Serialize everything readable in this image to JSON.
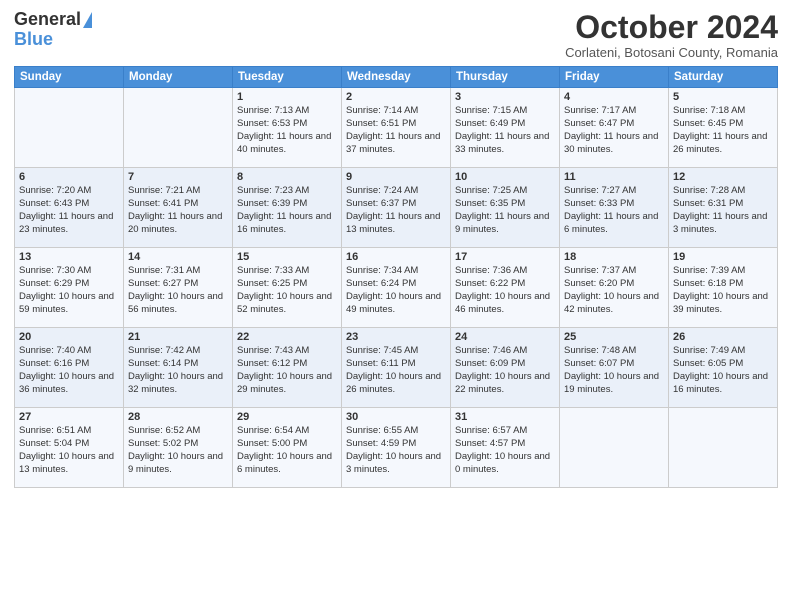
{
  "logo": {
    "general": "General",
    "blue": "Blue"
  },
  "title": "October 2024",
  "subtitle": "Corlateni, Botosani County, Romania",
  "weekdays": [
    "Sunday",
    "Monday",
    "Tuesday",
    "Wednesday",
    "Thursday",
    "Friday",
    "Saturday"
  ],
  "weeks": [
    [
      {
        "day": "",
        "info": ""
      },
      {
        "day": "",
        "info": ""
      },
      {
        "day": "1",
        "info": "Sunrise: 7:13 AM\nSunset: 6:53 PM\nDaylight: 11 hours and 40 minutes."
      },
      {
        "day": "2",
        "info": "Sunrise: 7:14 AM\nSunset: 6:51 PM\nDaylight: 11 hours and 37 minutes."
      },
      {
        "day": "3",
        "info": "Sunrise: 7:15 AM\nSunset: 6:49 PM\nDaylight: 11 hours and 33 minutes."
      },
      {
        "day": "4",
        "info": "Sunrise: 7:17 AM\nSunset: 6:47 PM\nDaylight: 11 hours and 30 minutes."
      },
      {
        "day": "5",
        "info": "Sunrise: 7:18 AM\nSunset: 6:45 PM\nDaylight: 11 hours and 26 minutes."
      }
    ],
    [
      {
        "day": "6",
        "info": "Sunrise: 7:20 AM\nSunset: 6:43 PM\nDaylight: 11 hours and 23 minutes."
      },
      {
        "day": "7",
        "info": "Sunrise: 7:21 AM\nSunset: 6:41 PM\nDaylight: 11 hours and 20 minutes."
      },
      {
        "day": "8",
        "info": "Sunrise: 7:23 AM\nSunset: 6:39 PM\nDaylight: 11 hours and 16 minutes."
      },
      {
        "day": "9",
        "info": "Sunrise: 7:24 AM\nSunset: 6:37 PM\nDaylight: 11 hours and 13 minutes."
      },
      {
        "day": "10",
        "info": "Sunrise: 7:25 AM\nSunset: 6:35 PM\nDaylight: 11 hours and 9 minutes."
      },
      {
        "day": "11",
        "info": "Sunrise: 7:27 AM\nSunset: 6:33 PM\nDaylight: 11 hours and 6 minutes."
      },
      {
        "day": "12",
        "info": "Sunrise: 7:28 AM\nSunset: 6:31 PM\nDaylight: 11 hours and 3 minutes."
      }
    ],
    [
      {
        "day": "13",
        "info": "Sunrise: 7:30 AM\nSunset: 6:29 PM\nDaylight: 10 hours and 59 minutes."
      },
      {
        "day": "14",
        "info": "Sunrise: 7:31 AM\nSunset: 6:27 PM\nDaylight: 10 hours and 56 minutes."
      },
      {
        "day": "15",
        "info": "Sunrise: 7:33 AM\nSunset: 6:25 PM\nDaylight: 10 hours and 52 minutes."
      },
      {
        "day": "16",
        "info": "Sunrise: 7:34 AM\nSunset: 6:24 PM\nDaylight: 10 hours and 49 minutes."
      },
      {
        "day": "17",
        "info": "Sunrise: 7:36 AM\nSunset: 6:22 PM\nDaylight: 10 hours and 46 minutes."
      },
      {
        "day": "18",
        "info": "Sunrise: 7:37 AM\nSunset: 6:20 PM\nDaylight: 10 hours and 42 minutes."
      },
      {
        "day": "19",
        "info": "Sunrise: 7:39 AM\nSunset: 6:18 PM\nDaylight: 10 hours and 39 minutes."
      }
    ],
    [
      {
        "day": "20",
        "info": "Sunrise: 7:40 AM\nSunset: 6:16 PM\nDaylight: 10 hours and 36 minutes."
      },
      {
        "day": "21",
        "info": "Sunrise: 7:42 AM\nSunset: 6:14 PM\nDaylight: 10 hours and 32 minutes."
      },
      {
        "day": "22",
        "info": "Sunrise: 7:43 AM\nSunset: 6:12 PM\nDaylight: 10 hours and 29 minutes."
      },
      {
        "day": "23",
        "info": "Sunrise: 7:45 AM\nSunset: 6:11 PM\nDaylight: 10 hours and 26 minutes."
      },
      {
        "day": "24",
        "info": "Sunrise: 7:46 AM\nSunset: 6:09 PM\nDaylight: 10 hours and 22 minutes."
      },
      {
        "day": "25",
        "info": "Sunrise: 7:48 AM\nSunset: 6:07 PM\nDaylight: 10 hours and 19 minutes."
      },
      {
        "day": "26",
        "info": "Sunrise: 7:49 AM\nSunset: 6:05 PM\nDaylight: 10 hours and 16 minutes."
      }
    ],
    [
      {
        "day": "27",
        "info": "Sunrise: 6:51 AM\nSunset: 5:04 PM\nDaylight: 10 hours and 13 minutes."
      },
      {
        "day": "28",
        "info": "Sunrise: 6:52 AM\nSunset: 5:02 PM\nDaylight: 10 hours and 9 minutes."
      },
      {
        "day": "29",
        "info": "Sunrise: 6:54 AM\nSunset: 5:00 PM\nDaylight: 10 hours and 6 minutes."
      },
      {
        "day": "30",
        "info": "Sunrise: 6:55 AM\nSunset: 4:59 PM\nDaylight: 10 hours and 3 minutes."
      },
      {
        "day": "31",
        "info": "Sunrise: 6:57 AM\nSunset: 4:57 PM\nDaylight: 10 hours and 0 minutes."
      },
      {
        "day": "",
        "info": ""
      },
      {
        "day": "",
        "info": ""
      }
    ]
  ]
}
